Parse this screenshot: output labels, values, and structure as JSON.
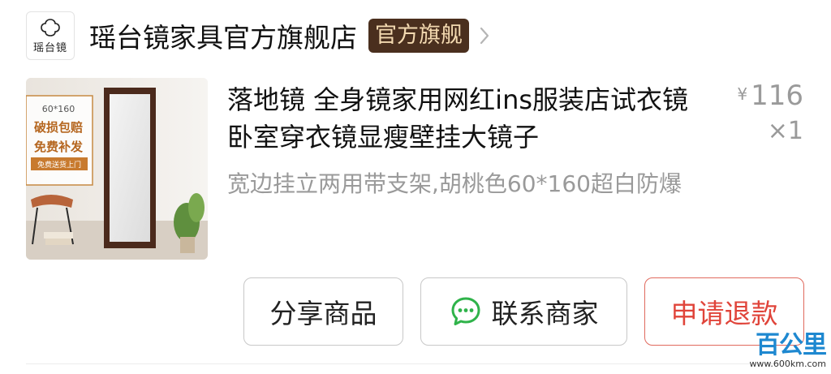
{
  "store": {
    "logo_text": "瑶台镜",
    "name": "瑶台镜家具官方旗舰店",
    "badge": "官方旗舰"
  },
  "product": {
    "image_text": {
      "size": "60*160",
      "line1": "破损包赔",
      "line2": "免费补发",
      "ribbon": "免费送货上门"
    },
    "title": "落地镜 全身镜家用网红ins服装店试衣镜卧室穿衣镜显瘦壁挂大镜子",
    "sku": "宽边挂立两用带支架,胡桃色60*160超白防爆",
    "currency": "¥",
    "price": "116",
    "quantity": "×1"
  },
  "actions": {
    "share": "分享商品",
    "contact": "联系商家",
    "refund": "申请退款"
  },
  "watermark": {
    "brand": "百公里",
    "url": "www.600km.com"
  },
  "colors": {
    "badge_bg": "#4a2f1e",
    "badge_text": "#f3d9b0",
    "refund_accent": "#e0443a",
    "chat_icon_green": "#2fb34a",
    "watermark_blue": "#1e88d0"
  }
}
